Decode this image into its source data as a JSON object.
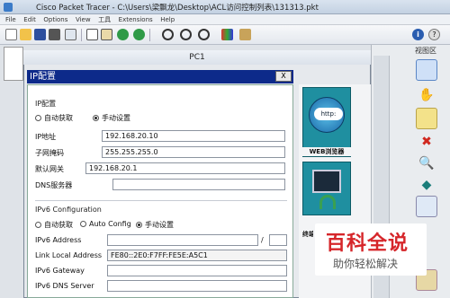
{
  "window": {
    "title": "Cisco Packet Tracer - C:\\Users\\梁飘龙\\Desktop\\ACL访问控制列表\\131313.pkt"
  },
  "menu": [
    "File",
    "Edit",
    "Options",
    "View",
    "工具",
    "Extensions",
    "Help"
  ],
  "right_panel": {
    "tab": "视图区"
  },
  "pc": {
    "title": "PC1",
    "ip_config_title": "IP配置",
    "close": "X",
    "ipv4": {
      "section": "IP配置",
      "dhcp_label": "自动获取",
      "static_label": "手动设置",
      "selected": "static",
      "ip_label": "IP地址",
      "ip_value": "192.168.20.10",
      "mask_label": "子网掩码",
      "mask_value": "255.255.255.0",
      "gateway_label": "默认网关",
      "gateway_value": "192.168.20.1",
      "dns_label": "DNS服务器",
      "dns_value": ""
    },
    "ipv6": {
      "section": "IPv6 Configuration",
      "dhcp_label": "自动获取",
      "auto_label": "Auto Config",
      "static_label": "手动设置",
      "selected": "static",
      "address_label": "IPv6 Address",
      "slash": "/",
      "link_local_label": "Link Local Address",
      "link_local_value": "FE80::2E0:F7FF:FE5E:A5C1",
      "gateway_label": "IPv6 Gateway",
      "dns_label": "IPv6 DNS Server"
    },
    "apps": {
      "web": "WEB浏览器",
      "terminal": "终端"
    }
  },
  "watermark": {
    "title": "百科全说",
    "subtitle": "助你轻松解决"
  },
  "colors": {
    "title_bar": "#0d2a8a",
    "app_tile": "#1f8fa0",
    "watermark_red": "#d6262a"
  }
}
